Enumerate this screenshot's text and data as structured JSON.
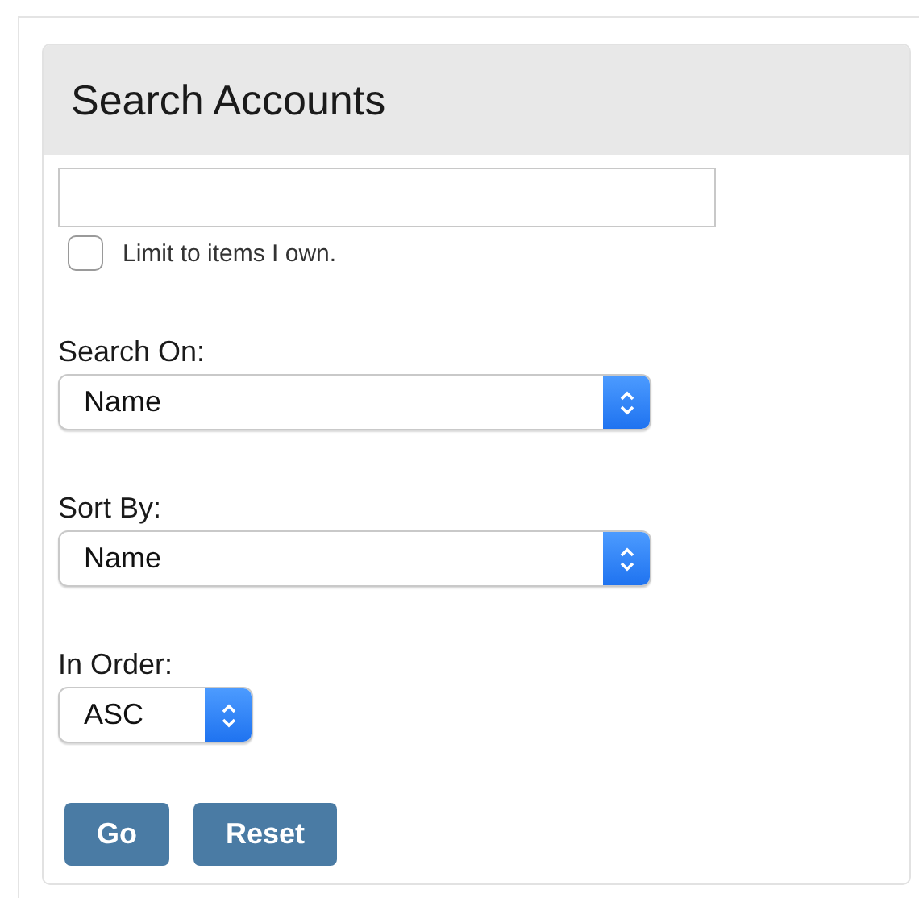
{
  "panel": {
    "title": "Search Accounts"
  },
  "limit_checkbox": {
    "label": "Limit to items I own.",
    "checked": false
  },
  "fields": [
    {
      "label": "Search On:",
      "value": "Name",
      "kind": "wide"
    },
    {
      "label": "Sort By:",
      "value": "Name",
      "kind": "wide"
    },
    {
      "label": "In Order:",
      "value": "ASC",
      "kind": "narrow"
    }
  ],
  "buttons": [
    "Go",
    "Reset"
  ]
}
